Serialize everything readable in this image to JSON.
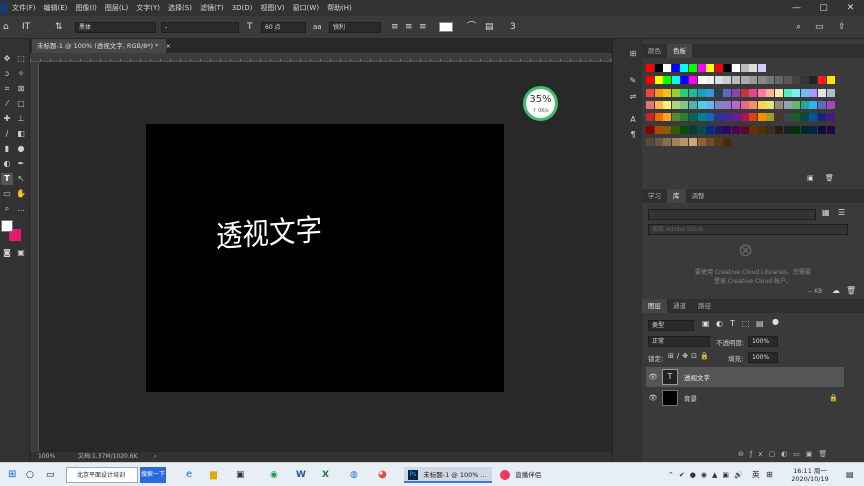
{
  "menu": [
    "文件(F)",
    "编辑(E)",
    "图像(I)",
    "图层(L)",
    "文字(Y)",
    "选择(S)",
    "滤镜(T)",
    "3D(D)",
    "视图(V)",
    "窗口(W)",
    "帮助(H)"
  ],
  "window_controls": {
    "minimize": "—",
    "restore": "▢",
    "close": "✕"
  },
  "options": {
    "font_family": "黑体",
    "font_style": "-",
    "font_size": "60 点",
    "aa_label": "aa",
    "antialias": "锐利"
  },
  "document": {
    "tab_title": "未标题-1 @ 100% (透视文字, RGB/8*) *",
    "tab_close": "×",
    "canvas_text": "透视文字",
    "zoom": "100%",
    "doc_info": "文档:1.37M/1020.6K",
    "arrow": "›"
  },
  "badge": {
    "percent": "35%",
    "speed": "↑ 0K/s",
    "accent": "#3fbf6a"
  },
  "color_panel": {
    "tabs": [
      "颜色",
      "色板"
    ],
    "active": 1
  },
  "library_panel": {
    "tabs": [
      "学习",
      "库",
      "调整"
    ],
    "active": 1,
    "search_placeholder": "搜索 Adobe Stock",
    "msg_line1": "要使用 Creative Cloud Libraries，您需要",
    "msg_line2": "登录 Creative Cloud 帐户。",
    "size": "-- KB"
  },
  "layers_panel": {
    "tabs": [
      "图层",
      "通道",
      "路径"
    ],
    "active": 0,
    "filter": "类型",
    "blend_mode": "正常",
    "opacity_label": "不透明度:",
    "opacity": "100%",
    "lock_label": "锁定:",
    "fill_label": "填充:",
    "fill": "100%",
    "layers": [
      {
        "name": "透视文字",
        "thumb": "T",
        "selected": true
      },
      {
        "name": "背景",
        "thumb": "",
        "selected": false
      }
    ]
  },
  "taskbar": {
    "search_text": "北京平面设计培训",
    "search_button": "搜索一下",
    "ps_task": "未标题-1 @ 100% ...",
    "live_task": "直播伴侣",
    "ime": "英",
    "time": "16:11 周一",
    "date": "2020/10/19"
  },
  "colors": {
    "foreground": "#ffffff",
    "background": "#e8176f"
  }
}
